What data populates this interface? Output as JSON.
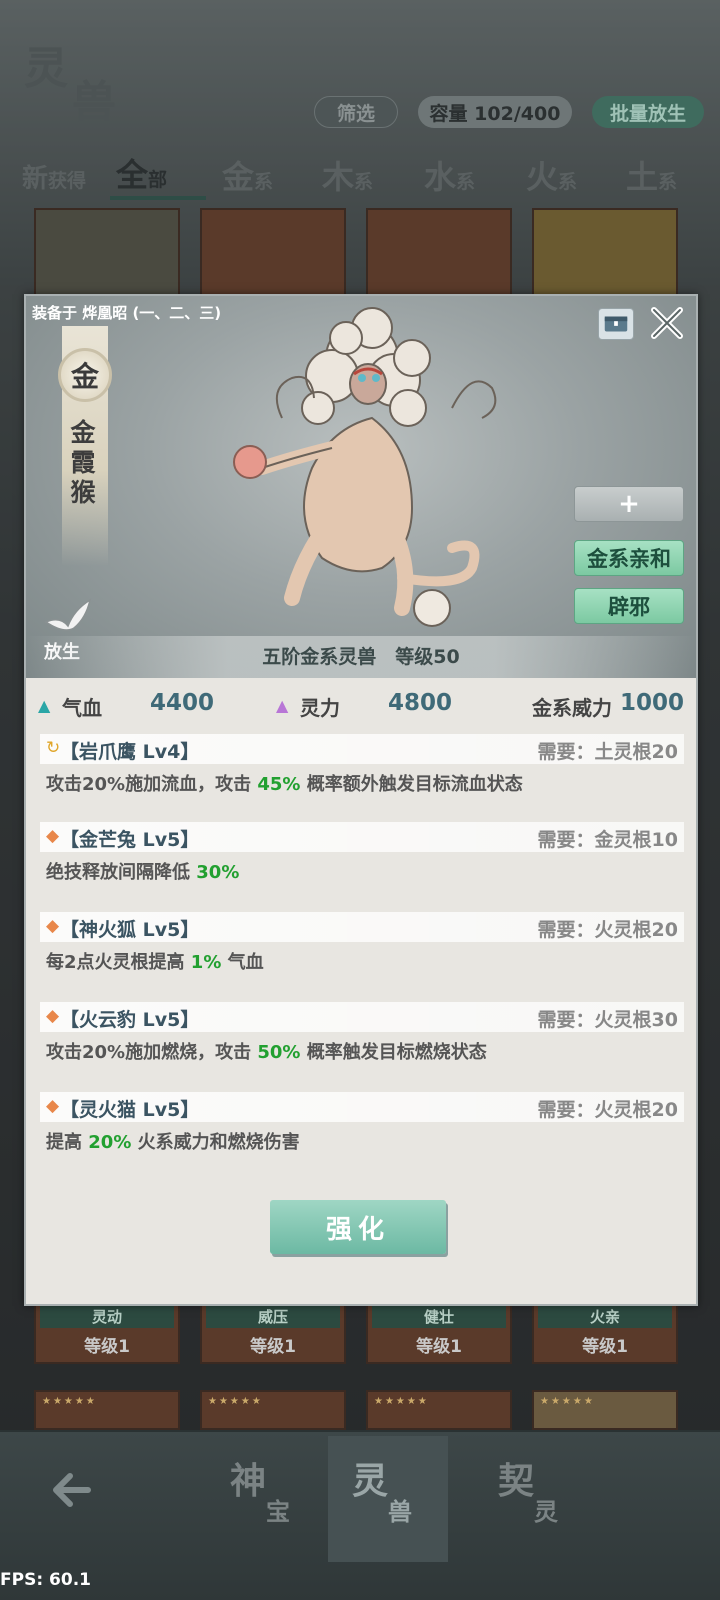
{
  "header": {
    "logo": [
      "灵",
      "兽"
    ],
    "filter_label": "筛选",
    "capacity_label": "容量 102/400",
    "batch_release_label": "批量放生"
  },
  "tabs": [
    {
      "big": "新",
      "small": "获得"
    },
    {
      "big": "全",
      "small": "部"
    },
    {
      "big": "金",
      "small": "系"
    },
    {
      "big": "木",
      "small": "系"
    },
    {
      "big": "水",
      "small": "系"
    },
    {
      "big": "火",
      "small": "系"
    },
    {
      "big": "土",
      "small": "系"
    }
  ],
  "background_cards": [
    {
      "label": "灵动",
      "level": "等级1"
    },
    {
      "label": "威压",
      "level": "等级1"
    },
    {
      "label": "健壮",
      "level": "等级1"
    },
    {
      "label": "火亲",
      "level": "等级1"
    }
  ],
  "popup": {
    "equipped_text": "装备于 烨凰昭 (一、二、三)",
    "element_badge": "金",
    "beast_name": "金霞猴",
    "release_label": "放生",
    "stage_text": "五阶金系灵兽　等级50",
    "plus_label": "+",
    "trait_buttons": [
      "金系亲和",
      "辟邪"
    ],
    "stats": {
      "hp_label": "气血",
      "hp_value": "4400",
      "mp_label": "灵力",
      "mp_value": "4800",
      "power_label": "金系威力",
      "power_value": "1000"
    },
    "skills": [
      {
        "icon": "refresh-icon",
        "name": "【岩爪鹰 Lv4】",
        "req": "需要：土灵根20",
        "desc_pre": "攻击20%施加流血，攻击 ",
        "desc_hl": "45%",
        "desc_post": " 概率额外触发目标流血状态"
      },
      {
        "icon": "diamond-icon",
        "name": "【金芒兔 Lv5】",
        "req": "需要：金灵根10",
        "desc_pre": "绝技释放间隔降低 ",
        "desc_hl": "30%",
        "desc_post": ""
      },
      {
        "icon": "diamond-icon",
        "name": "【神火狐 Lv5】",
        "req": "需要：火灵根20",
        "desc_pre": "每2点火灵根提高 ",
        "desc_hl": "1%",
        "desc_post": " 气血"
      },
      {
        "icon": "diamond-icon",
        "name": "【火云豹 Lv5】",
        "req": "需要：火灵根30",
        "desc_pre": "攻击20%施加燃烧，攻击 ",
        "desc_hl": "50%",
        "desc_post": " 概率触发目标燃烧状态"
      },
      {
        "icon": "diamond-icon",
        "name": "【灵火猫 Lv5】",
        "req": "需要：火灵根20",
        "desc_pre": "提高 ",
        "desc_hl": "20%",
        "desc_post": " 火系威力和燃烧伤害"
      }
    ],
    "enhance_label": "强化"
  },
  "bottom_nav": [
    {
      "n1": "神",
      "n2": "宝"
    },
    {
      "n1": "灵",
      "n2": "兽"
    },
    {
      "n1": "契",
      "n2": "灵"
    }
  ],
  "fps": "FPS: 60.1"
}
